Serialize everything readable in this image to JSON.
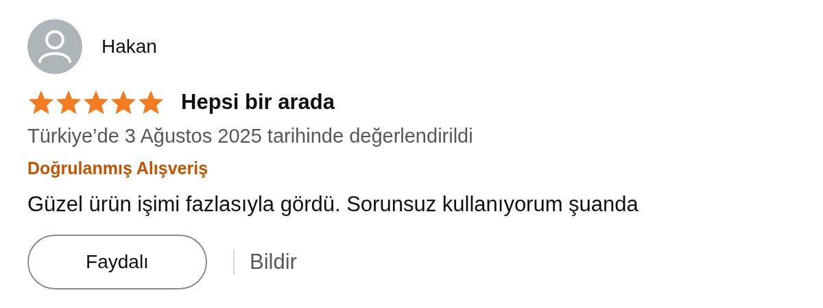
{
  "review": {
    "author": "Hakan",
    "stars": 5,
    "title": "Hepsi bir arada",
    "meta": "Türkiye’de 3 Ağustos 2025 tarihinde değerlendirildi",
    "badge": "Doğrulanmış Alışveriş",
    "body": "Güzel ürün işimi fazlasıyla gördü. Sorunsuz kullanıyorum şuanda",
    "helpful_button": "Faydalı",
    "report_link": "Bildir"
  }
}
